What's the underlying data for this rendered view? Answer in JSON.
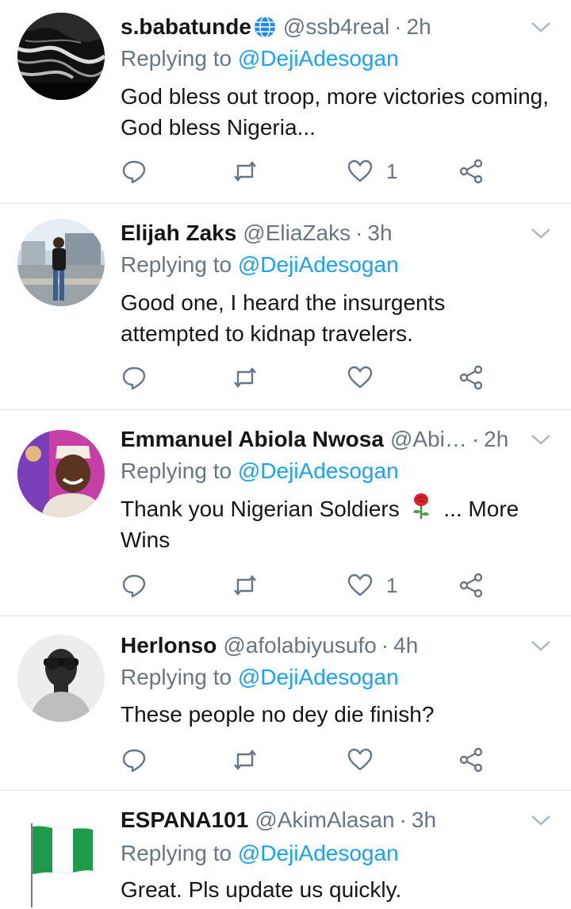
{
  "colors": {
    "accent": "#1da1f2",
    "muted": "#657786",
    "text": "#14171a",
    "divider": "#dcdfe2"
  },
  "reply_prefix": "Replying to",
  "tweets": [
    {
      "name": "s.babatunde",
      "handle": "@ssb4real",
      "time": "2h",
      "mention": "@DejiAdesogan",
      "text": "God bless out troop, more victories coming, God bless Nigeria...",
      "like_count": "1",
      "avatar": "ocean-waves-avatar"
    },
    {
      "name": "Elijah Zaks",
      "handle": "@EliaZaks",
      "time": "3h",
      "mention": "@DejiAdesogan",
      "text": "Good one, I heard the insurgents attempted to kidnap travelers.",
      "like_count": "",
      "avatar": "man-standing-avatar"
    },
    {
      "name": "Emmanuel Abiola Nwosa",
      "handle": "@Abi…",
      "time": "2h",
      "mention": "@DejiAdesogan",
      "text_before": "Thank you Nigerian Soldiers",
      "text_after": "... More Wins",
      "like_count": "1",
      "avatar": "smiling-man-cap-avatar"
    },
    {
      "name": "Herlonso",
      "handle": "@afolabiyusufo",
      "time": "4h",
      "mention": "@DejiAdesogan",
      "text": "These people no dey die finish?",
      "like_count": "",
      "avatar": "sunglasses-man-avatar"
    },
    {
      "name": "ESPANA101",
      "handle": "@AkimAlasan",
      "time": "3h",
      "mention": "@DejiAdesogan",
      "text": "Great. Pls update us quickly.",
      "avatar": "nigeria-flag-avatar"
    }
  ]
}
